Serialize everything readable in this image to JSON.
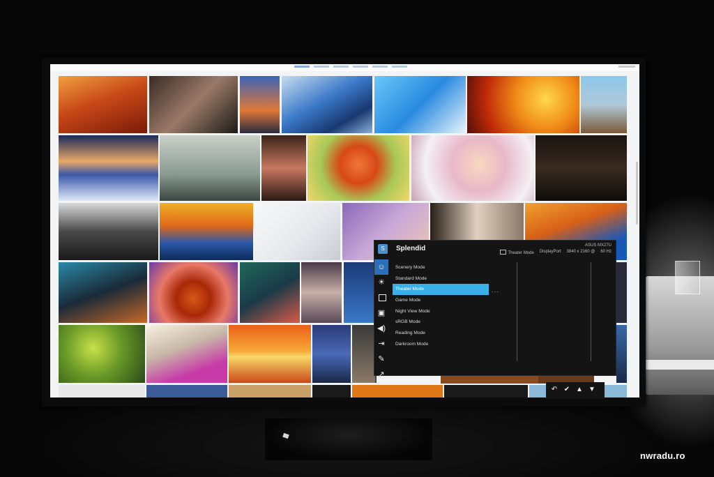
{
  "gallery": {
    "nav_tabs": 6
  },
  "osd": {
    "title": "Splendid",
    "model": "ASUS MX27U",
    "current_mode": "Theater Mode",
    "input": "DisplayPort",
    "resolution": "3840 x 2160 @",
    "refresh": "60 Hz",
    "modes": [
      {
        "label": "Scenery Mode"
      },
      {
        "label": "Standard Mode"
      },
      {
        "label": "Theater Mode"
      },
      {
        "label": "Game Mode"
      },
      {
        "label": "Night View Mode"
      },
      {
        "label": "sRGB Mode"
      },
      {
        "label": "Reading Mode"
      },
      {
        "label": "Darkroom Mode"
      }
    ],
    "selected_index": 2,
    "sidebar_icons": [
      "splendid-icon",
      "brightness-icon",
      "color-icon",
      "image-icon",
      "sound-icon",
      "input-select-icon",
      "system-setup-icon",
      "shortcut-icon"
    ],
    "keys": [
      "↶",
      "✔",
      "▲",
      "▼"
    ]
  },
  "colors": {
    "osd_bg": "#141414",
    "osd_highlight": "#3ab0e8",
    "osd_sidebar_selected": "#2a6fb8"
  },
  "watermark": "nwradu.ro"
}
